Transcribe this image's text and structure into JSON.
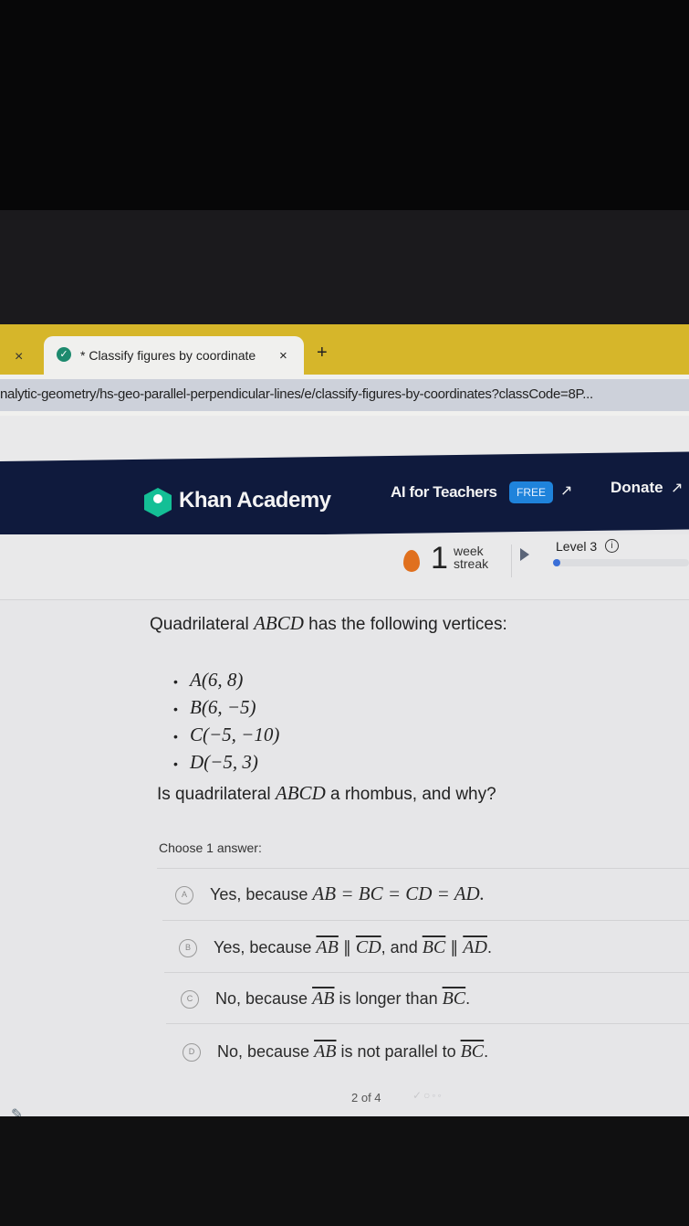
{
  "browser": {
    "tab_close_prev": "×",
    "tab_title": "* Classify figures by coordinate",
    "tab_close": "×",
    "new_tab": "+",
    "url": "nalytic-geometry/hs-geo-parallel-perpendicular-lines/e/classify-figures-by-coordinates?classCode=8P..."
  },
  "header": {
    "brand": "Khan Academy",
    "ai_for_teachers": "AI for Teachers",
    "free_badge": "FREE",
    "donate": "Donate",
    "ext_icon": "↗"
  },
  "streak": {
    "count": "1",
    "unit_top": "week",
    "unit_bottom": "streak"
  },
  "level": {
    "label": "Level 3",
    "info": "i",
    "progress_fraction": 0.03
  },
  "exercise": {
    "prompt_prefix": "Quadrilateral ",
    "prompt_math": "ABCD",
    "prompt_suffix": " has the following vertices:",
    "vertices": [
      "A(6, 8)",
      "B(6, −5)",
      "C(−5, −10)",
      "D(−5, 3)"
    ],
    "bullet": "•",
    "question_prefix": "Is quadrilateral ",
    "question_math": "ABCD",
    "question_suffix": " a rhombus, and why?",
    "choose_label": "Choose 1 answer:",
    "choices": [
      {
        "letter": "A",
        "text": "Yes, because ",
        "math": "AB = BC = CD = AD."
      },
      {
        "letter": "B",
        "text": "Yes, because ",
        "seg1": "AB",
        "par1": " ∥ ",
        "seg2": "CD",
        "mid": ", and ",
        "seg3": "BC",
        "par2": " ∥ ",
        "seg4": "AD",
        "end": "."
      },
      {
        "letter": "C",
        "text": "No, because ",
        "seg1": "AB",
        "mid": " is longer than ",
        "seg2": "BC",
        "end": "."
      },
      {
        "letter": "D",
        "text": "No, because ",
        "seg1": "AB",
        "mid": " is not parallel to ",
        "seg2": "BC",
        "end": "."
      }
    ],
    "progress": "2 of 4",
    "progress_marks": "✓○◦◦"
  }
}
